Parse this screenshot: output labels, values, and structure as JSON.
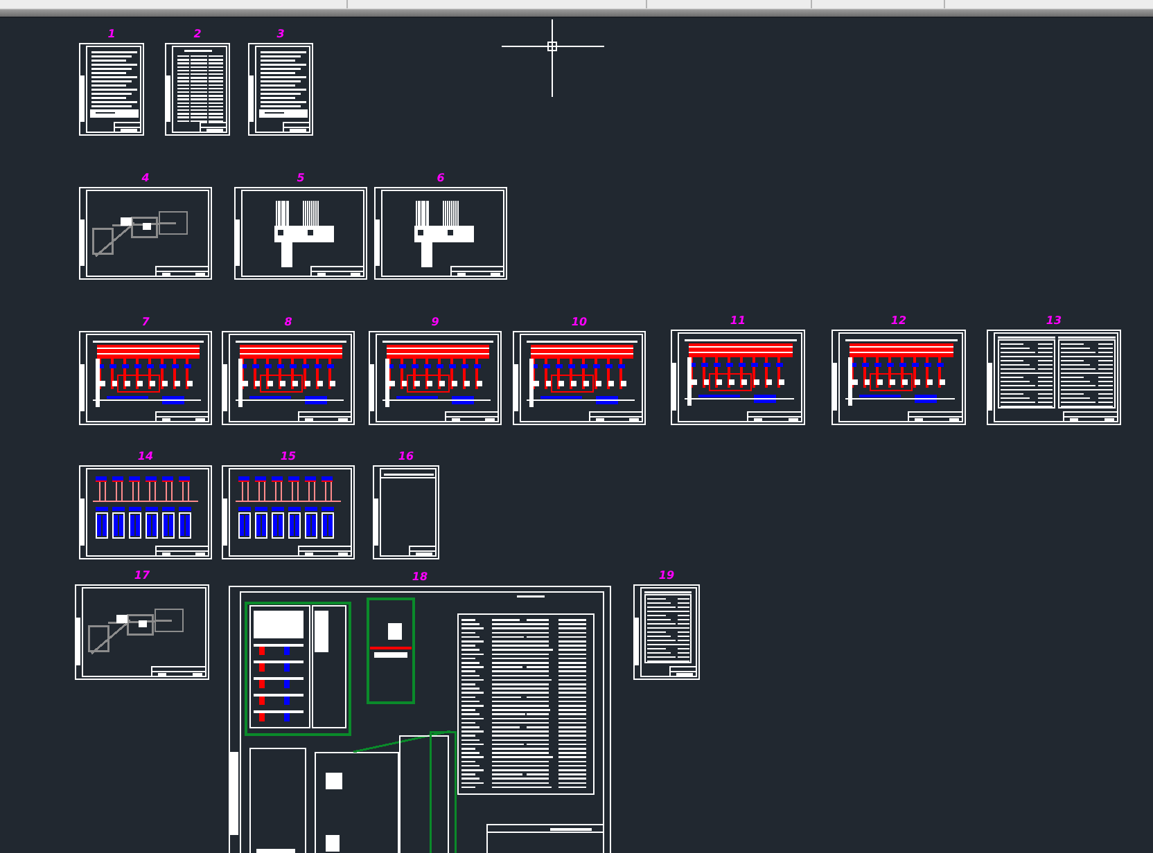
{
  "sheets": [
    {
      "number": "1",
      "kind": "text"
    },
    {
      "number": "2",
      "kind": "list"
    },
    {
      "number": "3",
      "kind": "text"
    },
    {
      "number": "4",
      "kind": "plan"
    },
    {
      "number": "5",
      "kind": "terminals"
    },
    {
      "number": "6",
      "kind": "terminals"
    },
    {
      "number": "7",
      "kind": "schematic"
    },
    {
      "number": "8",
      "kind": "schematic"
    },
    {
      "number": "9",
      "kind": "schematic"
    },
    {
      "number": "10",
      "kind": "schematic"
    },
    {
      "number": "11",
      "kind": "schematic"
    },
    {
      "number": "12",
      "kind": "schematic"
    },
    {
      "number": "13",
      "kind": "table"
    },
    {
      "number": "14",
      "kind": "wiring"
    },
    {
      "number": "15",
      "kind": "wiring"
    },
    {
      "number": "16",
      "kind": "blank"
    },
    {
      "number": "17",
      "kind": "plan"
    },
    {
      "number": "18",
      "kind": "assembly"
    },
    {
      "number": "19",
      "kind": "table"
    }
  ]
}
